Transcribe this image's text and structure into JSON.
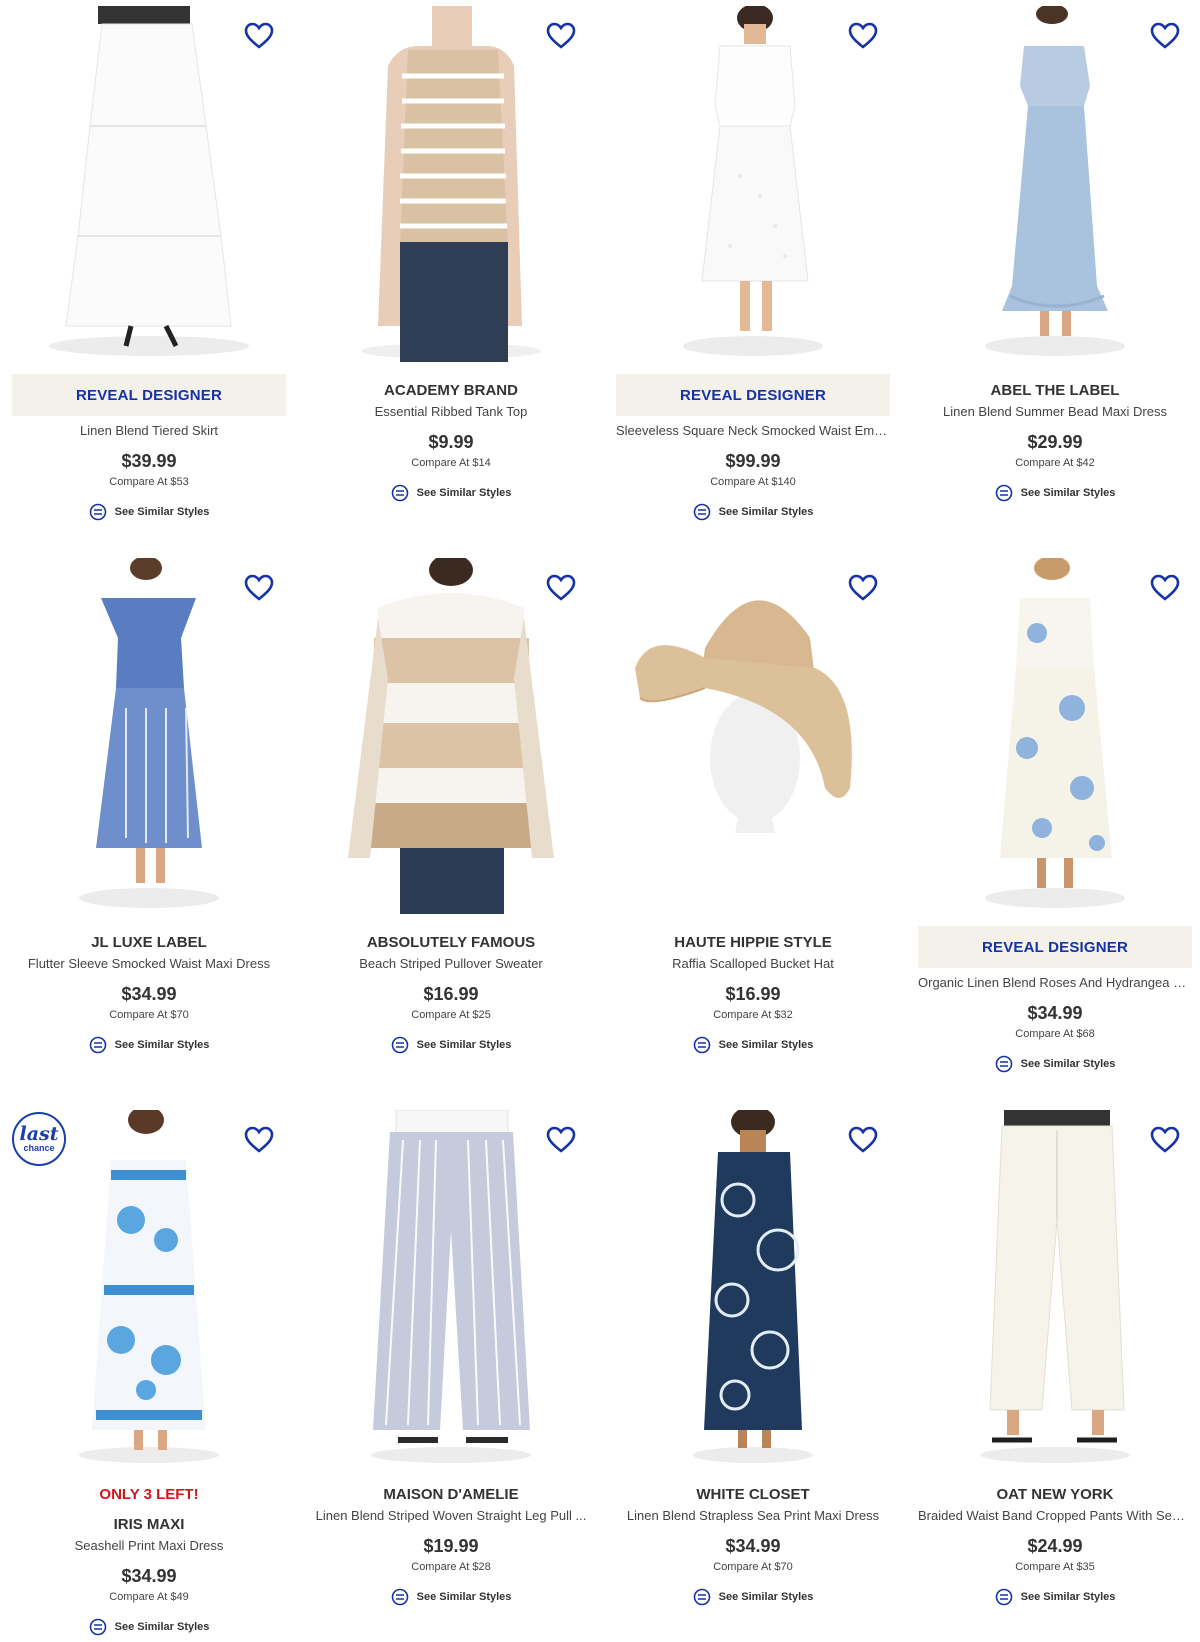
{
  "colors": {
    "accent": "#1533a6",
    "reveal_bg": "#f3f1e9",
    "stock_red": "#d0161d"
  },
  "icons": {
    "wishlist": "heart-outline-icon",
    "similar": "similar-styles-icon"
  },
  "products": [
    {
      "reveal": "REVEAL DESIGNER",
      "brand": "",
      "name": "Linen Blend Tiered Skirt",
      "price": "$39.99",
      "compare": "Compare At  $53",
      "similar": "See Similar Styles",
      "image": "white tiered maxi skirt"
    },
    {
      "reveal": "",
      "brand": "ACADEMY BRAND",
      "name": "Essential Ribbed Tank Top",
      "price": "$9.99",
      "compare": "Compare At  $14",
      "similar": "See Similar Styles",
      "image": "beige striped tank top"
    },
    {
      "reveal": "REVEAL DESIGNER",
      "brand": "",
      "name": "Sleeveless Square Neck Smocked Waist Embr...",
      "price": "$99.99",
      "compare": "Compare At  $140",
      "similar": "See Similar Styles",
      "image": "white eyelet midi dress"
    },
    {
      "reveal": "",
      "brand": "ABEL THE LABEL",
      "name": "Linen Blend Summer Bead Maxi Dress",
      "price": "$29.99",
      "compare": "Compare At  $42",
      "similar": "See Similar Styles",
      "image": "light blue maxi dress"
    },
    {
      "reveal": "",
      "brand": "JL LUXE LABEL",
      "name": "Flutter Sleeve Smocked Waist Maxi Dress",
      "price": "$34.99",
      "compare": "Compare At  $70",
      "similar": "See Similar Styles",
      "image": "blue print maxi dress"
    },
    {
      "reveal": "",
      "brand": "ABSOLUTELY FAMOUS",
      "name": "Beach Striped Pullover Sweater",
      "price": "$16.99",
      "compare": "Compare At  $25",
      "similar": "See Similar Styles",
      "image": "beige striped sweater"
    },
    {
      "reveal": "",
      "brand": "HAUTE HIPPIE STYLE",
      "name": "Raffia Scalloped Bucket Hat",
      "price": "$16.99",
      "compare": "Compare At  $32",
      "similar": "See Similar Styles",
      "image": "raffia bucket hat"
    },
    {
      "reveal": "REVEAL DESIGNER",
      "brand": "",
      "name": "Organic Linen Blend Roses And Hydrangea Mi...",
      "price": "$34.99",
      "compare": "Compare At  $68",
      "similar": "See Similar Styles",
      "image": "floral midi dress"
    },
    {
      "reveal": "",
      "stock": "ONLY 3 LEFT!",
      "badge": {
        "line1": "last",
        "line2": "chance"
      },
      "brand": "IRIS MAXI",
      "name": "Seashell Print Maxi Dress",
      "price": "$34.99",
      "compare": "Compare At  $49",
      "similar": "See Similar Styles",
      "image": "seashell print maxi dress"
    },
    {
      "reveal": "",
      "brand": "MAISON D'AMELIE",
      "name": "Linen Blend Striped Woven Straight Leg Pull ...",
      "price": "$19.99",
      "compare": "Compare At  $28",
      "similar": "See Similar Styles",
      "image": "striped linen pants"
    },
    {
      "reveal": "",
      "brand": "WHITE CLOSET",
      "name": "Linen Blend Strapless Sea Print Maxi Dress",
      "price": "$34.99",
      "compare": "Compare At  $70",
      "similar": "See Similar Styles",
      "image": "navy strapless maxi dress"
    },
    {
      "reveal": "",
      "brand": "OAT NEW YORK",
      "name": "Braided Waist Band Cropped Pants With Seas...",
      "price": "$24.99",
      "compare": "Compare At  $35",
      "similar": "See Similar Styles",
      "image": "white cropped pants"
    }
  ]
}
